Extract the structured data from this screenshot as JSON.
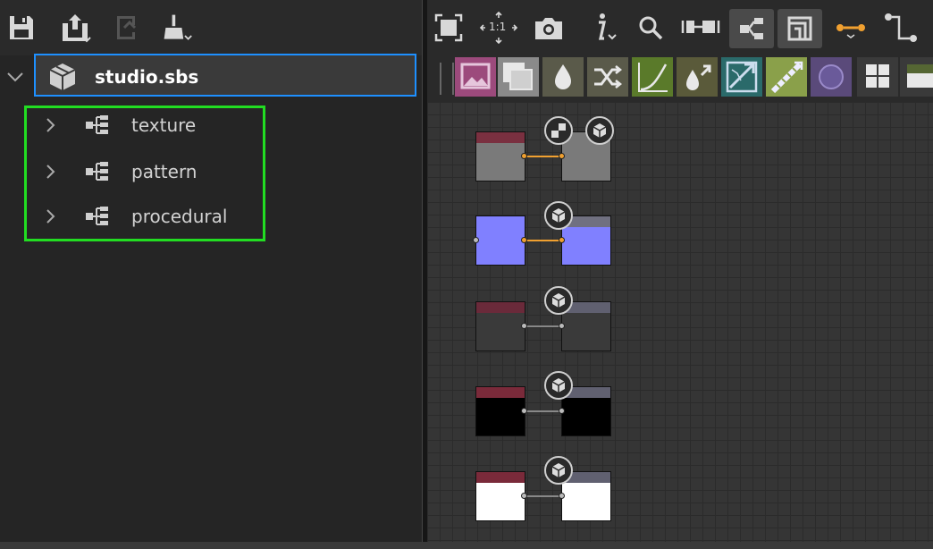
{
  "explorer": {
    "toolbar": [
      "save-icon",
      "publish-icon",
      "reload-icon",
      "clean-icon"
    ],
    "package": {
      "name": "studio.sbs",
      "icon": "package-icon"
    },
    "graphs": [
      {
        "label": "texture"
      },
      {
        "label": "pattern"
      },
      {
        "label": "procedural"
      }
    ]
  },
  "graph_view": {
    "toolbar": [
      "frame-all-icon",
      "zoom-1to1-icon",
      "screenshot-icon",
      "info-icon",
      "search-icon",
      "tabs-icon",
      "layout-icon",
      "frame-icon",
      "link-icon",
      "connector-icon"
    ],
    "zoom_label": "1:1",
    "library_icons": [
      {
        "name": "bitmap-icon",
        "color": "#9c4a7c"
      },
      {
        "name": "svg-icon",
        "color": "#8a8a8a"
      },
      {
        "name": "uniform-color-icon",
        "color": "#5a5a4a"
      },
      {
        "name": "blend-icon",
        "color": "#5a5a4a"
      },
      {
        "name": "levels-icon",
        "color": "#5a7a2a"
      },
      {
        "name": "color-fill-icon",
        "color": "#5a5a3a"
      },
      {
        "name": "transform-icon",
        "color": "#2a6a6a"
      },
      {
        "name": "gradient-icon",
        "color": "#8aa04a"
      },
      {
        "name": "shape-icon",
        "color": "#5a4a7a"
      },
      {
        "name": "grid-icon",
        "color": "#3a3a3a"
      },
      {
        "name": "output-icon",
        "color": "#3a3a3a"
      }
    ],
    "accent": "#1e90ff",
    "highlight": "#22dd22",
    "wire_active": "#f0a030"
  }
}
